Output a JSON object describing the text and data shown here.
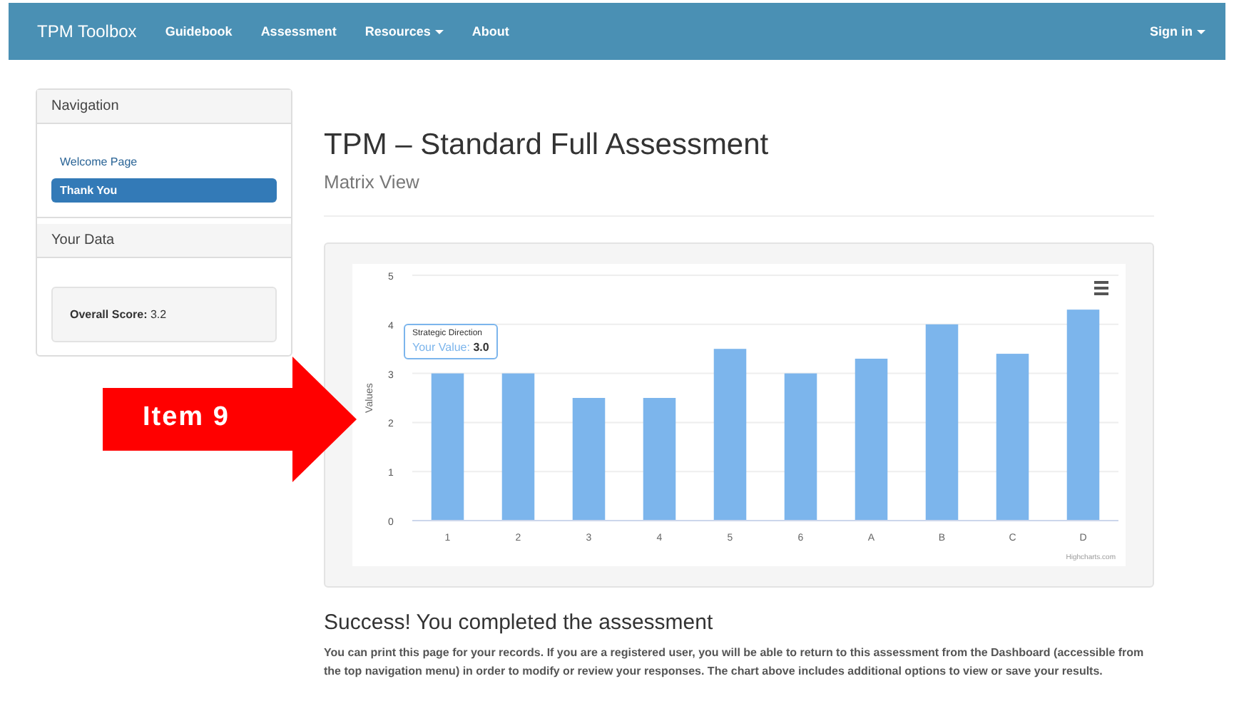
{
  "navbar": {
    "brand": "TPM Toolbox",
    "items": [
      {
        "label": "Guidebook",
        "dropdown": false
      },
      {
        "label": "Assessment",
        "dropdown": false
      },
      {
        "label": "Resources",
        "dropdown": true
      },
      {
        "label": "About",
        "dropdown": false
      }
    ],
    "account": {
      "label": "Sign in",
      "dropdown": true
    }
  },
  "sidebar": {
    "navigation": {
      "title": "Navigation",
      "items": [
        {
          "label": "Welcome Page",
          "selected": false
        },
        {
          "label": "Thank You",
          "selected": true
        }
      ]
    },
    "your_data": {
      "title": "Your Data",
      "score_label": "Overall Score:",
      "score": "3.2"
    }
  },
  "page": {
    "title": "TPM – Standard Full Assessment",
    "subtitle": "Matrix View"
  },
  "chart": {
    "chart_data": {
      "type": "bar",
      "ylabel": "Values",
      "categories": [
        "1",
        "2",
        "3",
        "4",
        "5",
        "6",
        "A",
        "B",
        "C",
        "D"
      ],
      "series": [
        {
          "color": "#7cb5ec",
          "values": [
            3.0,
            3.0,
            2.5,
            2.5,
            3.5,
            3.0,
            3.3,
            4.0,
            3.4,
            4.3
          ]
        }
      ],
      "ylim": [
        0,
        5
      ],
      "yticks": [
        0,
        1,
        2,
        3,
        4,
        5
      ],
      "grid": true
    },
    "tooltip": {
      "title": "Strategic Direction",
      "label": "Your Value:",
      "value": "3.0"
    },
    "credit": "Highcharts.com"
  },
  "callout": {
    "text": "Item 9"
  },
  "success": {
    "heading": "Success! You completed the assessment",
    "body": "You can print this page for your records. If you are a registered user, you will be able to return to this assessment from the Dashboard (accessible from the top navigation menu) in order to modify or review your responses. The chart above includes additional options to view or save your results."
  }
}
